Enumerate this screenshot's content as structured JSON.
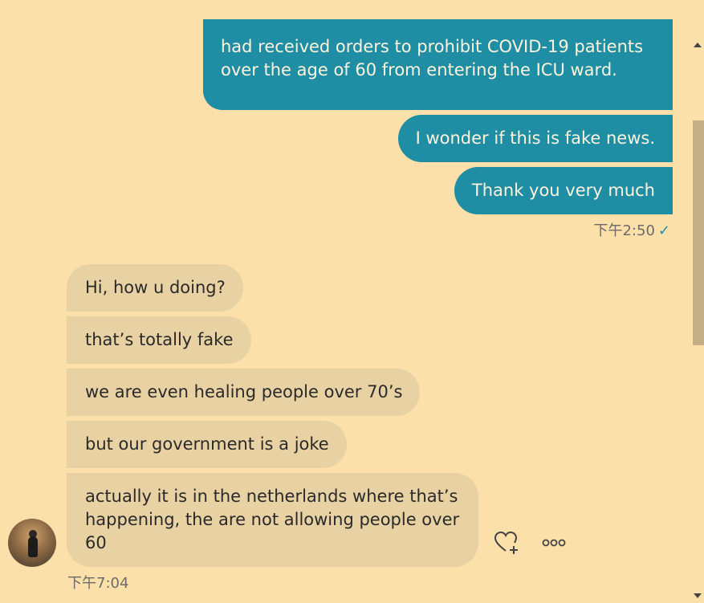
{
  "outgoing": {
    "messages": [
      "had received orders to prohibit COVID-19 patients over the age of 60 from entering the ICU ward.",
      "I wonder if this is fake news.",
      "Thank you very much"
    ],
    "timestamp": "下午2:50",
    "read_mark": "✓"
  },
  "incoming": {
    "messages": [
      "Hi, how u doing?",
      "that’s totally fake",
      "we are even healing people over 70’s",
      "but our government is a joke",
      "actually it is in the netherlands where that’s happening, the are not allowing people over 60"
    ],
    "timestamp": "下午7:04"
  },
  "icons": {
    "react": "heart-plus-icon",
    "more": "more-options-icon"
  },
  "colors": {
    "background": "#fce0a9",
    "outgoing_bubble": "#1f8ea5",
    "incoming_bubble": "#e8d1a3"
  }
}
